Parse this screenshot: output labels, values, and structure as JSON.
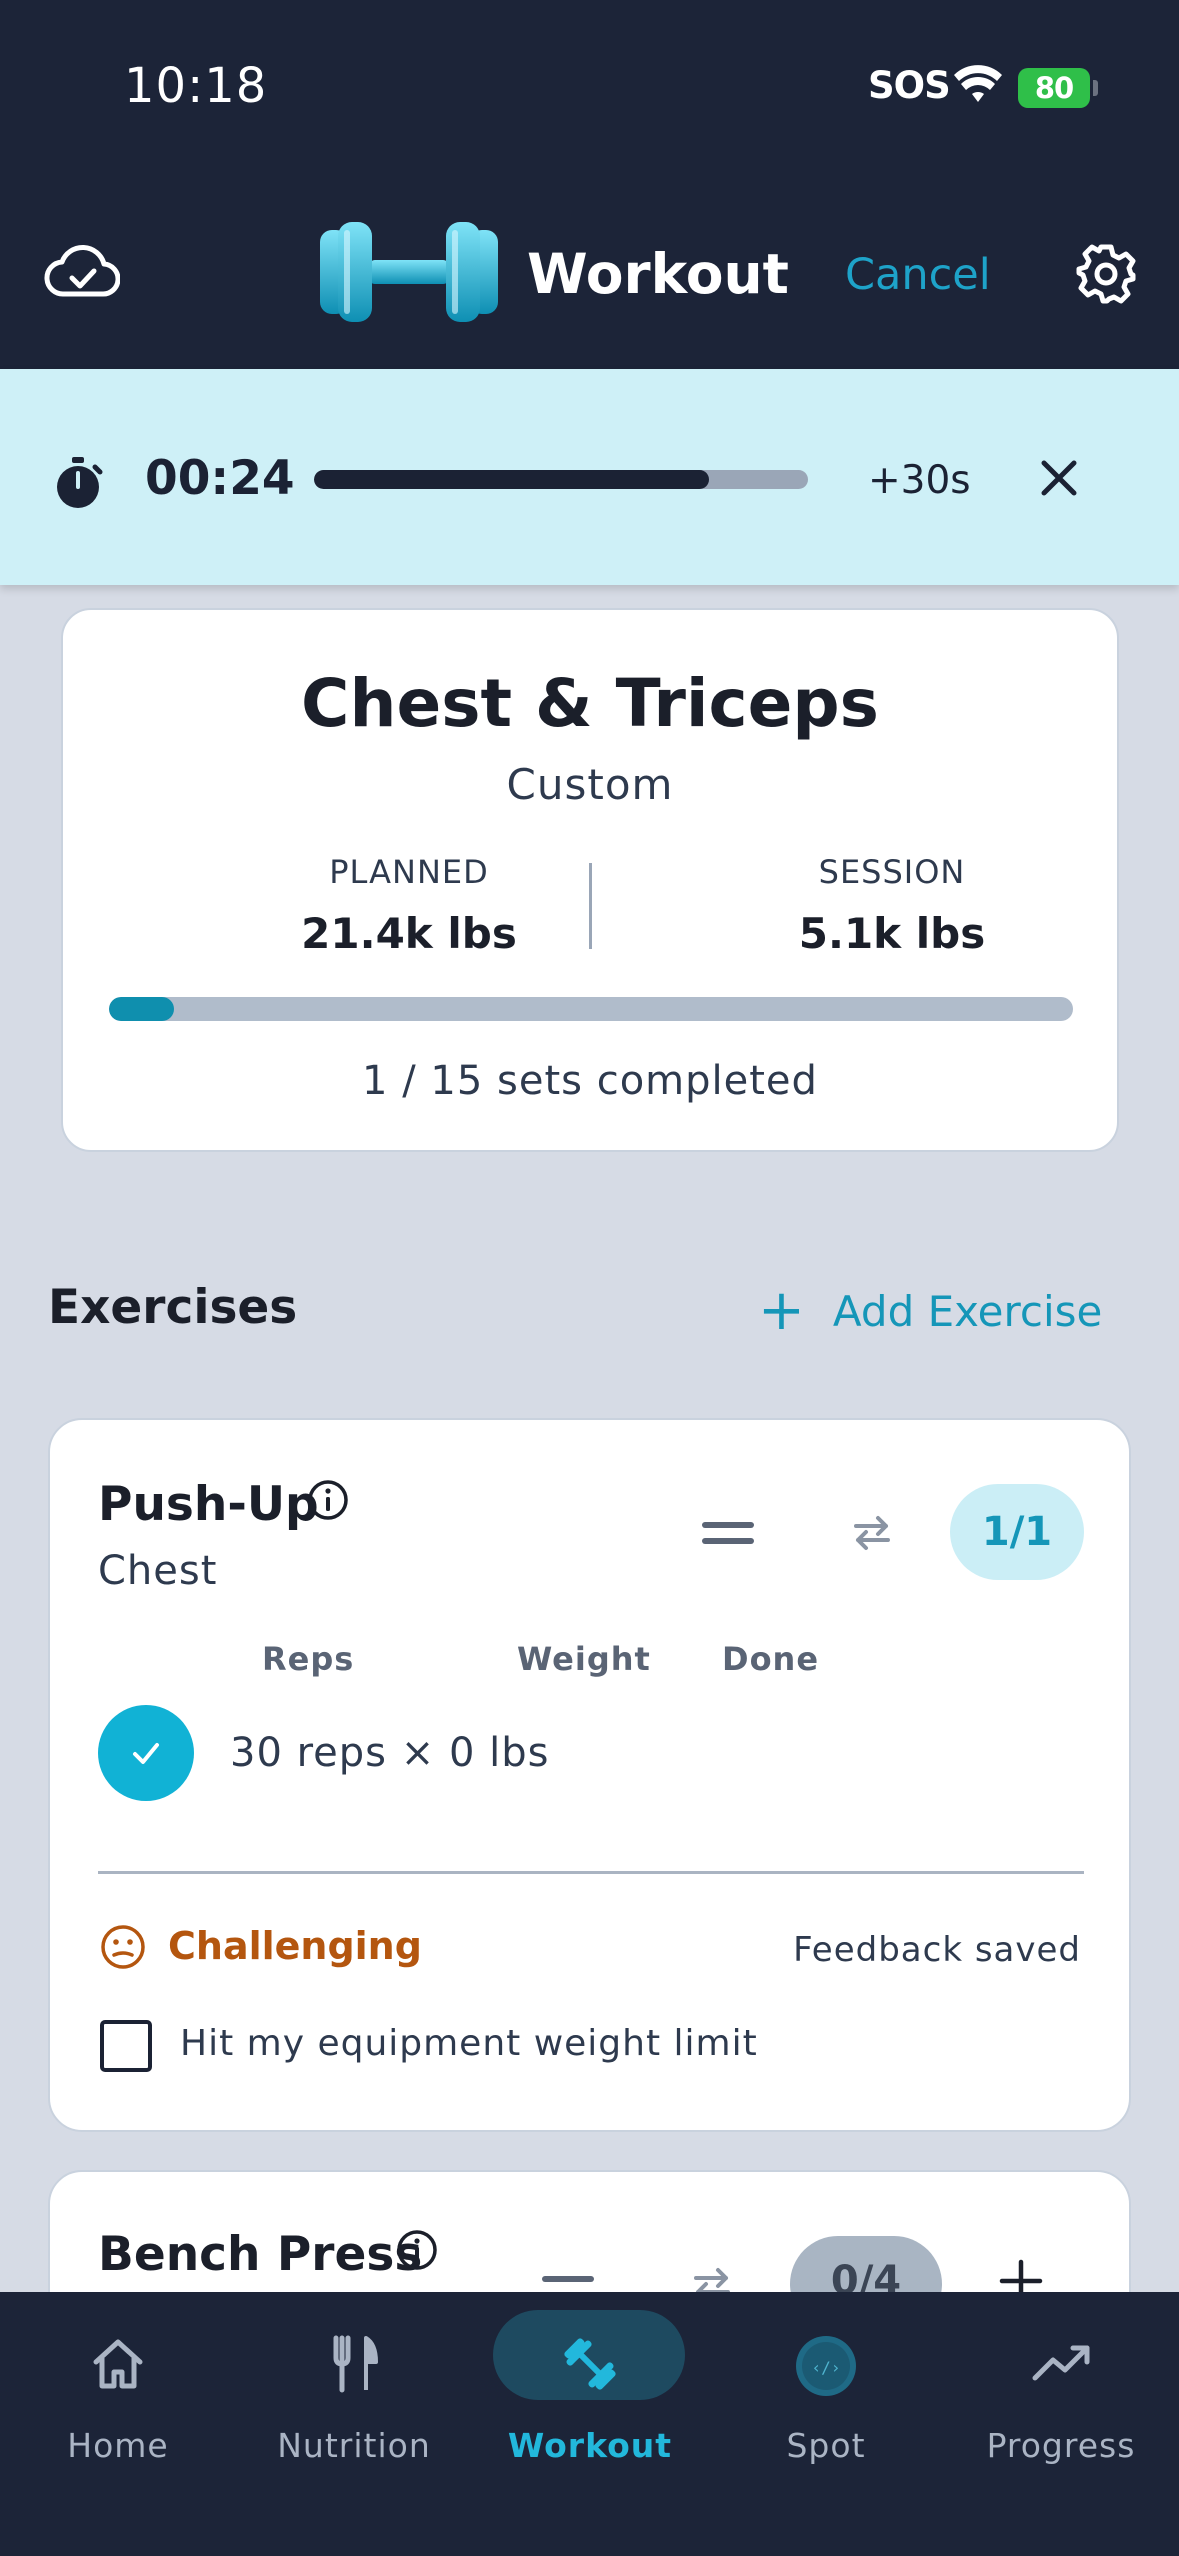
{
  "status_bar": {
    "time": "10:18",
    "sos": "SOS",
    "battery": "80"
  },
  "header": {
    "title": "Workout",
    "cancel_label": "Cancel"
  },
  "rest_timer": {
    "time": "00:24",
    "progress": 0.8,
    "add_label": "+30s"
  },
  "summary": {
    "title": "Chest & Triceps",
    "subtitle": "Custom",
    "planned_label": "PLANNED",
    "planned_value": "21.4k lbs",
    "session_label": "SESSION",
    "session_value": "5.1k lbs",
    "sets_progress": 0.067,
    "sets_text": "1 / 15 sets completed"
  },
  "exercises_section": {
    "heading": "Exercises",
    "add_label": "Add Exercise"
  },
  "exercises": [
    {
      "name": "Push-Up",
      "muscle": "Chest",
      "count": "1/1",
      "columns": {
        "reps": "Reps",
        "weight": "Weight",
        "done": "Done"
      },
      "set_text": "30 reps × 0 lbs",
      "feedback": "Challenging",
      "feedback_status": "Feedback saved",
      "weight_limit_label": "Hit my equipment weight limit"
    },
    {
      "name": "Bench Press",
      "count": "0/4"
    }
  ],
  "tabs": [
    {
      "label": "Home",
      "icon": "home-icon"
    },
    {
      "label": "Nutrition",
      "icon": "fork-knife-icon"
    },
    {
      "label": "Workout",
      "icon": "dumbbell-icon"
    },
    {
      "label": "Spot",
      "icon": "spot-orb-icon"
    },
    {
      "label": "Progress",
      "icon": "trend-icon"
    }
  ],
  "colors": {
    "header_bg": "#1c2438",
    "accent": "#11b2d5",
    "timer_bg": "#cef0f7",
    "feedback": "#b4560f"
  }
}
